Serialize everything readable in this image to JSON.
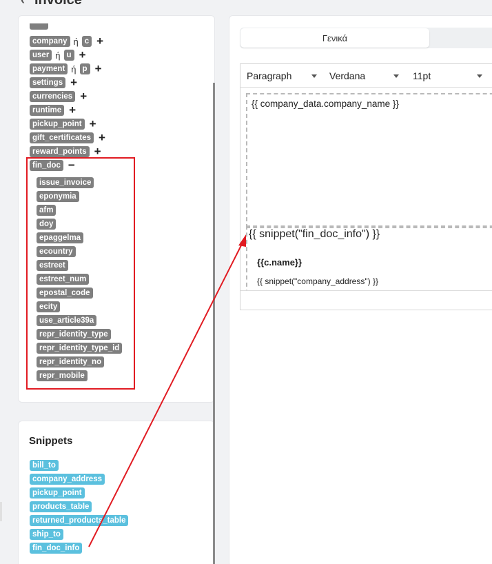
{
  "header": {
    "title": "Invoice",
    "back_icon": "‹"
  },
  "variables": {
    "rows": [
      {
        "name": "company",
        "alias": "c"
      },
      {
        "name": "user",
        "alias": "u"
      },
      {
        "name": "payment",
        "alias": "p"
      },
      {
        "name": "settings"
      },
      {
        "name": "currencies"
      },
      {
        "name": "runtime"
      },
      {
        "name": "pickup_point"
      },
      {
        "name": "gift_certificates"
      },
      {
        "name": "reward_points"
      },
      {
        "name": "fin_doc"
      }
    ],
    "or_label": "ή",
    "plus": "+",
    "minus": "−",
    "fin_doc_fields": [
      "issue_invoice",
      "eponymia",
      "afm",
      "doy",
      "epaggelma",
      "ecountry",
      "estreet",
      "estreet_num",
      "epostal_code",
      "ecity",
      "use_article39a",
      "repr_identity_type",
      "repr_identity_type_id",
      "repr_identity_no",
      "repr_mobile"
    ]
  },
  "snippets": {
    "title": "Snippets",
    "items": [
      "bill_to",
      "company_address",
      "pickup_point",
      "products_table",
      "returned_products_table",
      "ship_to",
      "fin_doc_info"
    ]
  },
  "tabs": {
    "active": "Γενικά"
  },
  "toolbar": {
    "block": "Paragraph",
    "font": "Verdana",
    "size": "11pt"
  },
  "editor": {
    "line1": "{{ company_data.company_name }}",
    "line2": "{{ snippet(\"fin_doc_info\") }}",
    "cname": "{{c.name}}",
    "addr": "{{ snippet(\"company_address\") }}"
  },
  "colors": {
    "annotation": "#e11b22",
    "variable_tag": "#7f7f7f",
    "snippet_tag": "#5bc0de"
  }
}
